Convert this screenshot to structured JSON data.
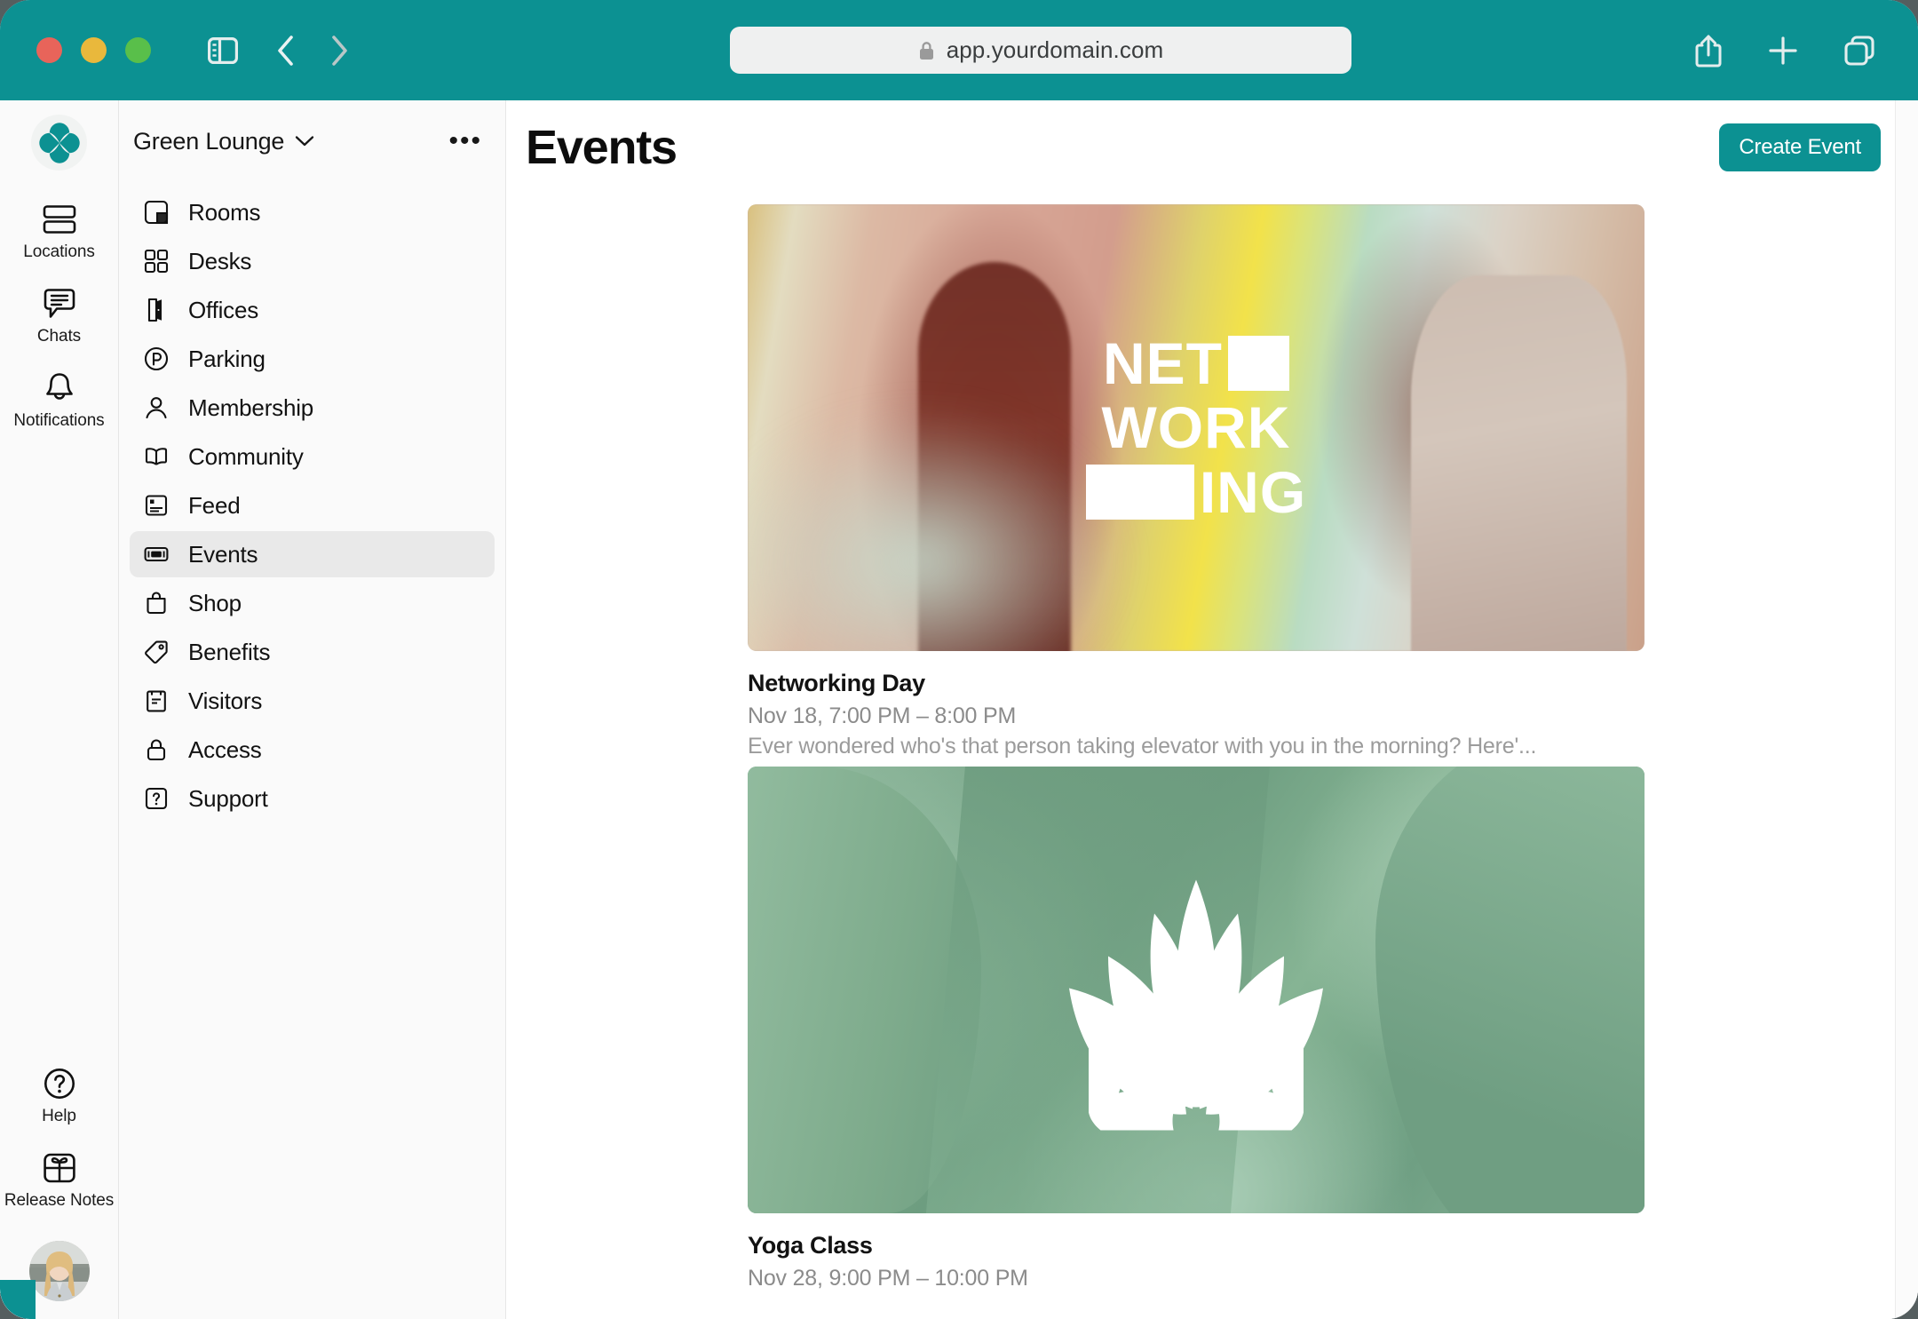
{
  "browser": {
    "url": "app.yourdomain.com",
    "lock_icon": "lock-icon",
    "sidebar_toggle_icon": "sidebar-toggle-icon",
    "back_icon": "chevron-left-icon",
    "forward_icon": "chevron-right-icon",
    "share_icon": "share-icon",
    "new_tab_icon": "plus-icon",
    "tabs_icon": "tabs-overview-icon",
    "traffic_lights": [
      "close",
      "minimize",
      "zoom"
    ],
    "chrome_color": "#0c9192"
  },
  "rail": {
    "logo_name": "quatrefoil-logo",
    "items": [
      {
        "label": "Locations",
        "icon": "stacked-panels-icon"
      },
      {
        "label": "Chats",
        "icon": "chat-bubble-icon"
      },
      {
        "label": "Notifications",
        "icon": "bell-icon"
      }
    ],
    "bottom_items": [
      {
        "label": "Help",
        "icon": "question-circle-icon"
      },
      {
        "label": "Release Notes",
        "icon": "gift-icon"
      }
    ],
    "avatar_name": "user-avatar"
  },
  "sidebar": {
    "workspace": "Green Lounge",
    "workspace_chevron_icon": "chevron-down-icon",
    "more_icon": "ellipsis-icon",
    "more_label": "•••",
    "items": [
      {
        "label": "Rooms",
        "icon": "room-layout-icon",
        "active": false
      },
      {
        "label": "Desks",
        "icon": "grid-squares-icon",
        "active": false
      },
      {
        "label": "Offices",
        "icon": "open-door-icon",
        "active": false
      },
      {
        "label": "Parking",
        "icon": "parking-p-icon",
        "active": false
      },
      {
        "label": "Membership",
        "icon": "person-icon",
        "active": false
      },
      {
        "label": "Community",
        "icon": "open-book-icon",
        "active": false
      },
      {
        "label": "Feed",
        "icon": "article-card-icon",
        "active": false
      },
      {
        "label": "Events",
        "icon": "ticket-icon",
        "active": true
      },
      {
        "label": "Shop",
        "icon": "shopping-bag-icon",
        "active": false
      },
      {
        "label": "Benefits",
        "icon": "price-tag-icon",
        "active": false
      },
      {
        "label": "Visitors",
        "icon": "clipboard-icon",
        "active": false
      },
      {
        "label": "Access",
        "icon": "lock-icon",
        "active": false
      },
      {
        "label": "Support",
        "icon": "help-square-icon",
        "active": false
      }
    ]
  },
  "main": {
    "title": "Events",
    "create_button": "Create Event",
    "accent_color": "#0c9192",
    "events": [
      {
        "title": "Networking Day",
        "time": "Nov 18, 7:00 PM – 8:00 PM",
        "description": "Ever wondered who's that person taking elevator with you in the morning? Here'...",
        "media": "networking-photo",
        "media_text_lines": [
          "NET",
          "WORK",
          "ING"
        ]
      },
      {
        "title": "Yoga Class",
        "time": "Nov 28, 9:00 PM – 10:00 PM",
        "description": "",
        "media": "lotus-illustration",
        "media_text_lines": []
      }
    ]
  }
}
